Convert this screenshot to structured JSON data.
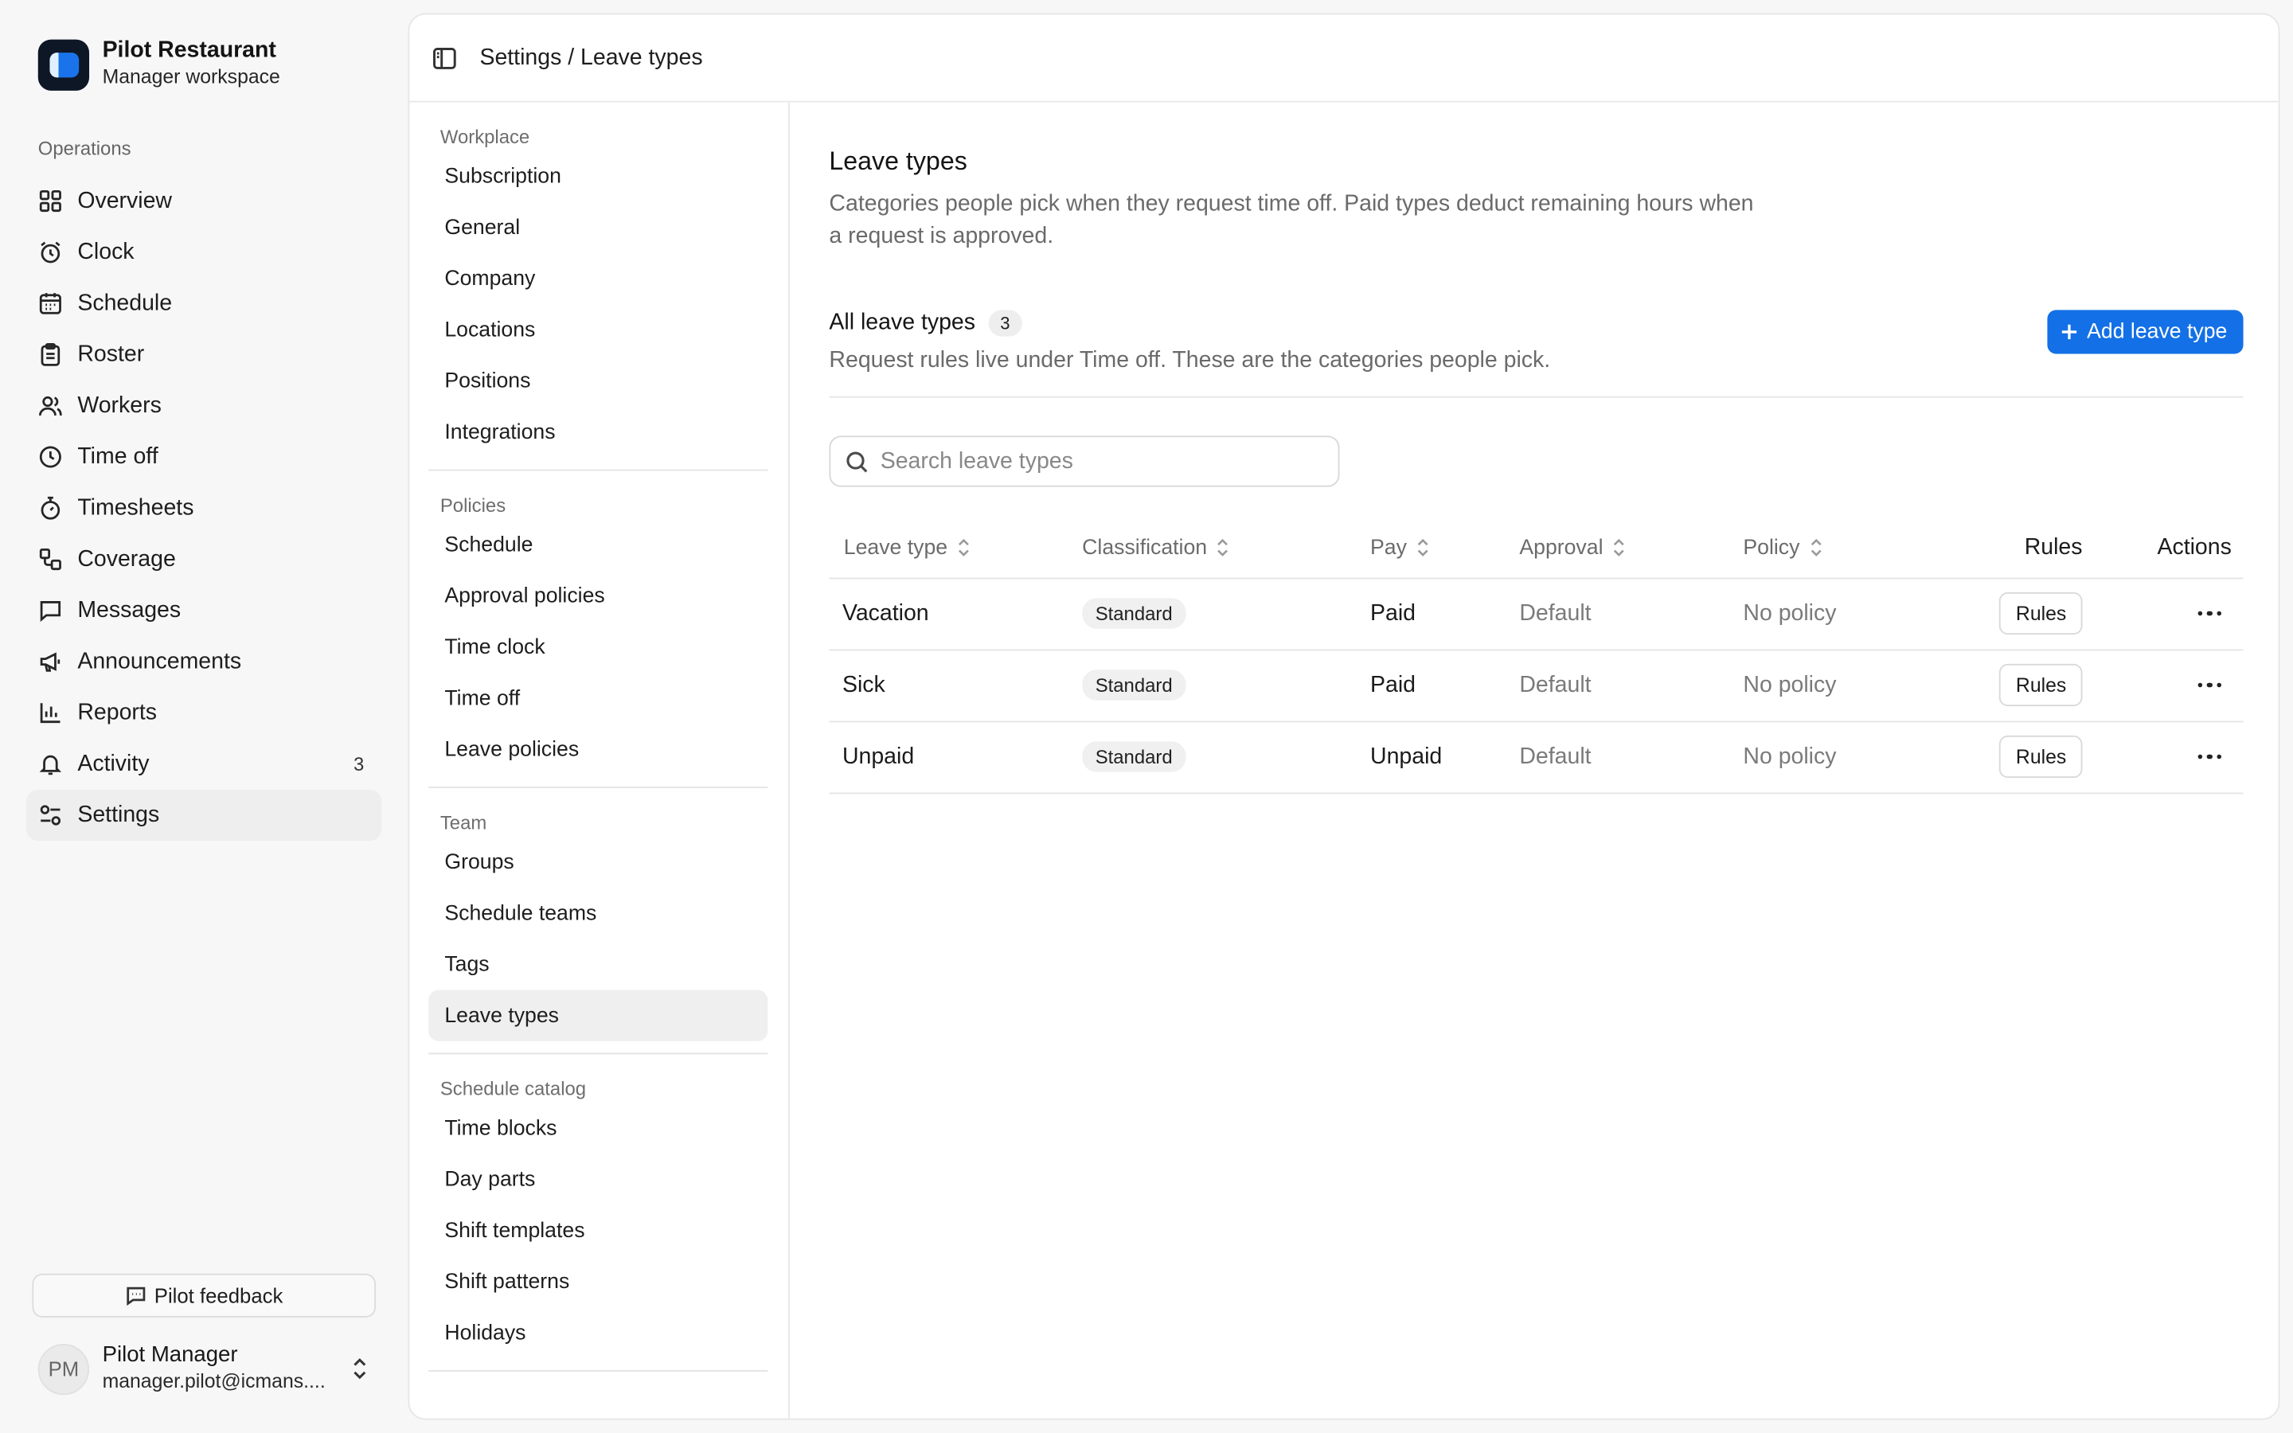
{
  "brand": {
    "name": "Pilot Restaurant",
    "subtitle": "Manager workspace"
  },
  "nav": {
    "heading": "Operations",
    "items": [
      {
        "label": "Overview",
        "icon": "grid-icon"
      },
      {
        "label": "Clock",
        "icon": "alarm-clock-icon"
      },
      {
        "label": "Schedule",
        "icon": "calendar-icon"
      },
      {
        "label": "Roster",
        "icon": "clipboard-icon"
      },
      {
        "label": "Workers",
        "icon": "users-icon"
      },
      {
        "label": "Time off",
        "icon": "clock-icon"
      },
      {
        "label": "Timesheets",
        "icon": "stopwatch-icon"
      },
      {
        "label": "Coverage",
        "icon": "coverage-icon"
      },
      {
        "label": "Messages",
        "icon": "message-icon"
      },
      {
        "label": "Announcements",
        "icon": "megaphone-icon"
      },
      {
        "label": "Reports",
        "icon": "bar-chart-icon"
      },
      {
        "label": "Activity",
        "icon": "bell-icon",
        "badge": "3"
      },
      {
        "label": "Settings",
        "icon": "sliders-icon",
        "active": true
      }
    ]
  },
  "feedback": {
    "label": "Pilot feedback"
  },
  "user": {
    "initials": "PM",
    "name": "Pilot Manager",
    "email": "manager.pilot@icmans...."
  },
  "topbar": {
    "breadcrumb": "Settings / Leave types"
  },
  "subnav": {
    "groups": [
      {
        "title": "Workplace",
        "items": [
          "Subscription",
          "General",
          "Company",
          "Locations",
          "Positions",
          "Integrations"
        ]
      },
      {
        "title": "Policies",
        "items": [
          "Schedule",
          "Approval policies",
          "Time clock",
          "Time off",
          "Leave policies"
        ]
      },
      {
        "title": "Team",
        "items": [
          "Groups",
          "Schedule teams",
          "Tags",
          "Leave types"
        ]
      },
      {
        "title": "Schedule catalog",
        "items": [
          "Time blocks",
          "Day parts",
          "Shift templates",
          "Shift patterns",
          "Holidays"
        ]
      }
    ],
    "active": "Leave types"
  },
  "page": {
    "title": "Leave types",
    "description": "Categories people pick when they request time off. Paid types deduct remaining hours when a request is approved."
  },
  "section": {
    "title": "All leave types",
    "count": "3",
    "description": "Request rules live under Time off. These are the categories people pick.",
    "add_label": "Add leave type"
  },
  "search": {
    "placeholder": "Search leave types",
    "value": ""
  },
  "table": {
    "headers": [
      "Leave type",
      "Classification",
      "Pay",
      "Approval",
      "Policy",
      "Rules",
      "Actions"
    ],
    "rows": [
      {
        "name": "Vacation",
        "classification": "Standard",
        "pay": "Paid",
        "approval": "Default",
        "policy": "No policy",
        "rules": "Rules"
      },
      {
        "name": "Sick",
        "classification": "Standard",
        "pay": "Paid",
        "approval": "Default",
        "policy": "No policy",
        "rules": "Rules"
      },
      {
        "name": "Unpaid",
        "classification": "Standard",
        "pay": "Unpaid",
        "approval": "Default",
        "policy": "No policy",
        "rules": "Rules"
      }
    ]
  },
  "colors": {
    "accent": "#1370e6",
    "brand_dark": "#0e1726"
  }
}
